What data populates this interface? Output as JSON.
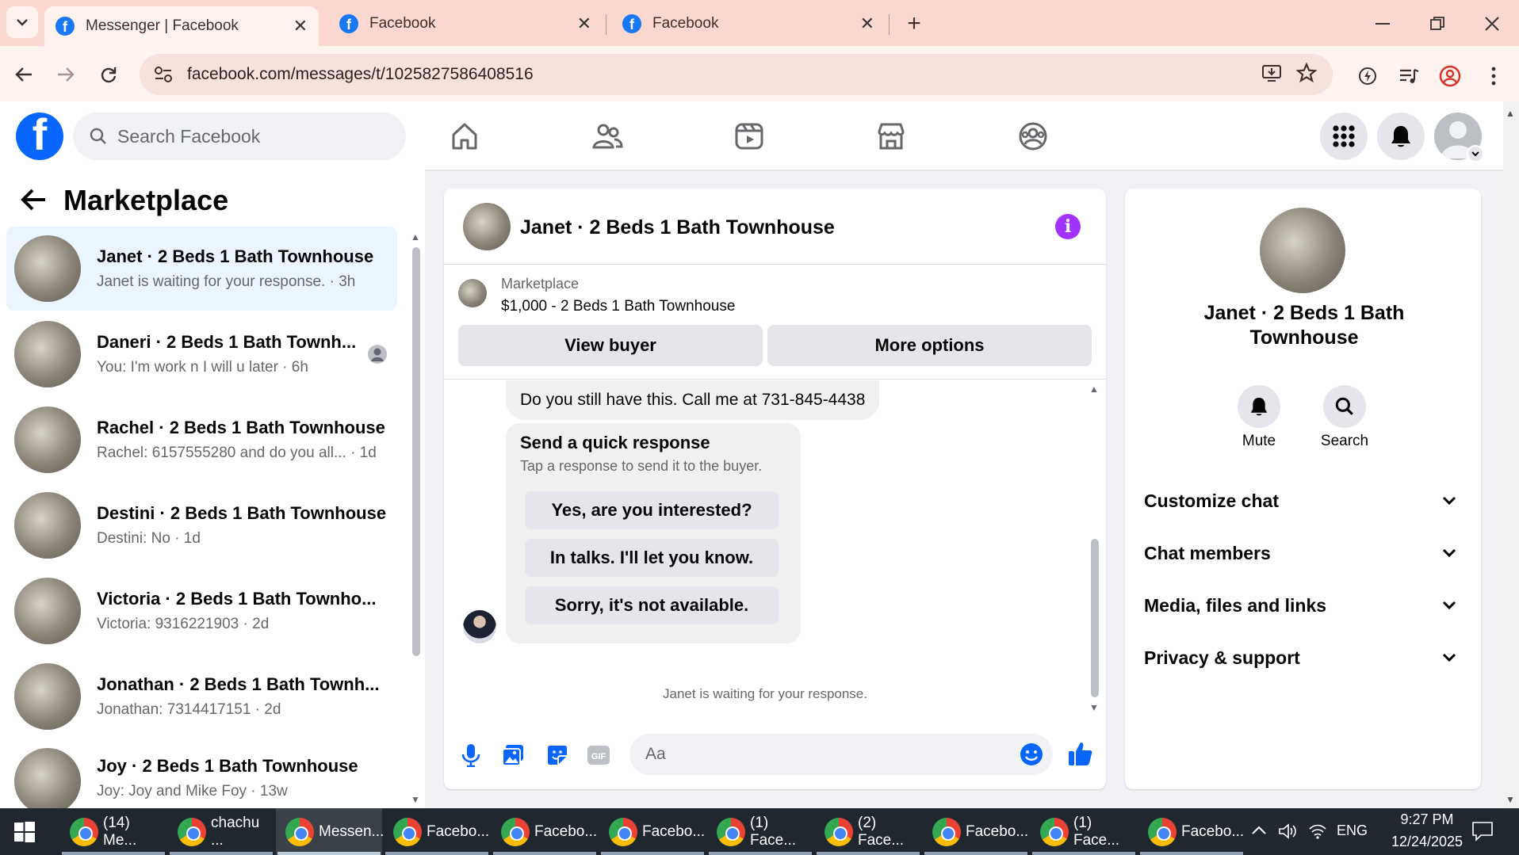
{
  "browser": {
    "tabs": [
      {
        "title": "Messenger | Facebook",
        "active": true
      },
      {
        "title": "Facebook",
        "active": false
      },
      {
        "title": "Facebook",
        "active": false
      }
    ],
    "new_tab_label": "+",
    "url": "facebook.com/messages/t/1025827586408516"
  },
  "header": {
    "logo_letter": "f",
    "search_placeholder": "Search Facebook",
    "nav_icons": [
      "home-icon",
      "friends-icon",
      "video-icon",
      "marketplace-icon",
      "groups-icon"
    ]
  },
  "left": {
    "title": "Marketplace",
    "conversations": [
      {
        "name": "Janet · 2 Beds 1 Bath Townhouse",
        "preview": "Janet is waiting for your response. · 3h",
        "selected": true
      },
      {
        "name": "Daneri · 2 Beds 1 Bath Townh...",
        "preview": "You: I'm work n I will u later · 6h",
        "selected": false
      },
      {
        "name": "Rachel · 2 Beds 1 Bath Townhouse",
        "preview": "Rachel: 6157555280 and do you all... · 1d",
        "selected": false
      },
      {
        "name": "Destini · 2 Beds 1 Bath Townhouse",
        "preview": "Destini: No · 1d",
        "selected": false
      },
      {
        "name": "Victoria · 2 Beds 1 Bath Townho...",
        "preview": "Victoria: 9316221903 · 2d",
        "selected": false
      },
      {
        "name": "Jonathan · 2 Beds 1 Bath Townh...",
        "preview": "Jonathan: 7314417151 · 2d",
        "selected": false
      },
      {
        "name": "Joy · 2 Beds 1 Bath Townhouse",
        "preview": "Joy: Joy and Mike Foy · 13w",
        "selected": false
      }
    ]
  },
  "chat": {
    "title": "Janet · 2 Beds 1 Bath Townhouse",
    "listing_source": "Marketplace",
    "listing_title": "$1,000 - 2 Beds 1 Bath Townhouse",
    "view_buyer": "View buyer",
    "more_options": "More options",
    "message": "Do you still have this.   Call me at 731-845-4438",
    "quick_title": "Send a quick response",
    "quick_sub": "Tap a response to send it to the buyer.",
    "quick_responses": [
      "Yes, are you interested?",
      "In talks. I'll let you know.",
      "Sorry, it's not available."
    ],
    "status": "Janet is waiting for your response.",
    "input_placeholder": "Aa"
  },
  "details": {
    "name": "Janet · 2 Beds 1 Bath Townhouse",
    "mute_label": "Mute",
    "search_label": "Search",
    "sections": [
      "Customize chat",
      "Chat members",
      "Media, files and links",
      "Privacy & support"
    ]
  },
  "taskbar": {
    "items": [
      "(14) Me...",
      "chachu ...",
      "Messen...",
      "Facebo...",
      "Facebo...",
      "Facebo...",
      "(1) Face...",
      "(2) Face...",
      "Facebo...",
      "(1) Face...",
      "Facebo..."
    ],
    "language": "ENG",
    "time": "9:27 PM",
    "date": "12/24/2025"
  },
  "colors": {
    "facebook_blue": "#0866ff",
    "info_purple": "#a033ff",
    "chrome_tabbar": "#fbd8cf",
    "taskbar": "#20272e"
  }
}
